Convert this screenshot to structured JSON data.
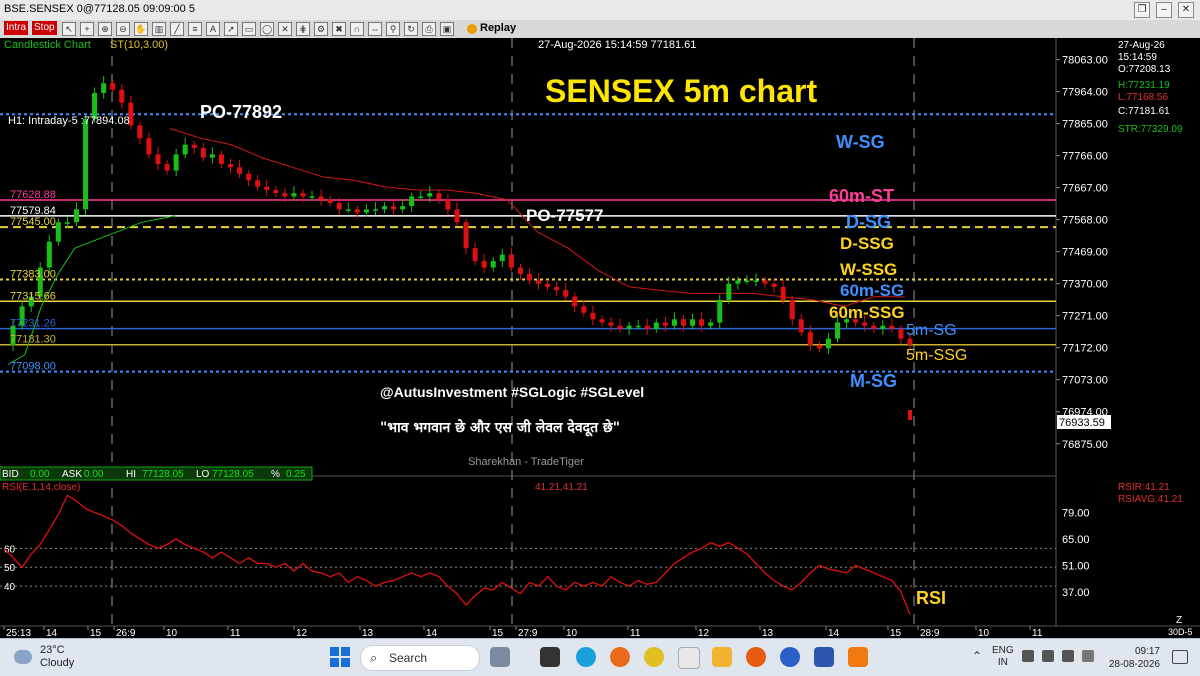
{
  "window": {
    "title": "BSE.SENSEX 0@77128.05 09:09:00 5"
  },
  "toolbar": {
    "badges": [
      "Intra",
      "Stop"
    ],
    "replay_label": "Replay"
  },
  "chart_header": {
    "chart_type_label": "Candlestick Chart",
    "indicator_label": "ST(10,3.00)",
    "datetime_label": "27-Aug-2026 15:14:59 77181.61",
    "title": "SENSEX 5m chart"
  },
  "ohlc_panel": {
    "date": "27-Aug-26",
    "time": "15:14:59",
    "open": "O:77208.13",
    "high": "H:77231.19",
    "low": "L:77168.56",
    "close": "C:77181.61",
    "str": "STR:77329.09"
  },
  "h1_label": "H1: Intraday-5 :77894.08",
  "current_price": "76933.59",
  "price_axis": [
    "78063.00",
    "77964.00",
    "77865.00",
    "77766.00",
    "77667.00",
    "77568.00",
    "77469.00",
    "77370.00",
    "77271.00",
    "77172.00",
    "77073.00",
    "76974.00",
    "76875.00"
  ],
  "levels": [
    {
      "name": "W-SG",
      "value": 77894,
      "color": "#3f8fff",
      "style": "dotted",
      "left_label": "",
      "right_label": "W-SG"
    },
    {
      "name": "60m-ST",
      "value": 77628.88,
      "color": "#ff3d9a",
      "style": "solid",
      "left_label": "77628.88",
      "right_label": "60m-ST"
    },
    {
      "name": "D-SG",
      "value": 77579.84,
      "color": "#ffffff",
      "style": "solid",
      "left_label": "77579.84",
      "right_label": "D-SG"
    },
    {
      "name": "D-SSG",
      "value": 77545,
      "color": "#e6d23a",
      "style": "dashed",
      "left_label": "77545.00",
      "right_label": "D-SSG"
    },
    {
      "name": "W-SSG",
      "value": 77383,
      "color": "#e6d23a",
      "style": "dotted",
      "left_label": "77383.00",
      "right_label": "W-SSG"
    },
    {
      "name": "60m-SG",
      "value": 77315.66,
      "color": "#e6d23a",
      "style": "solid",
      "left_label": "77315.66",
      "right_label": "60m-SG"
    },
    {
      "name": "5m-SG",
      "value": 77231.26,
      "color": "#2f62d6",
      "style": "solid",
      "left_label": "77231.26",
      "right_label": "5m-SG"
    },
    {
      "name": "5m-SSG",
      "value": 77181.3,
      "color": "#c9b230",
      "style": "solid",
      "left_label": "77181.30",
      "right_label": "5m-SSG"
    },
    {
      "name": "M-SG",
      "value": 77098,
      "color": "#3f8fff",
      "style": "dotted",
      "left_label": "77098.00",
      "right_label": "M-SG"
    }
  ],
  "annotations": {
    "po_high": "PO-77892",
    "po_mid": "PO-77577",
    "right_60m_ssg": "60m-SSG",
    "handles": "@AutusInvestment #SGLogic #SGLevel",
    "quote": "\"भाव भगवान छे और एस जी लेवल देवदूत छे\"",
    "watermark": "Sharekhan - TradeTiger",
    "rsi_label": "RSI"
  },
  "status_bar": {
    "bid_label": "BID",
    "bid_value": "0.00",
    "ask_label": "ASK",
    "ask_value": "0.00",
    "hi_label": "HI",
    "hi_value": "77128.05",
    "lo_label": "LO",
    "lo_value": "77128.05",
    "pct_label": "%",
    "pct_value": "0.25"
  },
  "rsi_panel": {
    "title": "RSI(E,1,14,close)",
    "value_center": "41.21,41.21",
    "rsir": "RSIR:41.21",
    "rsiavg": "RSIAVG:41.21",
    "axis": [
      "79.00",
      "65.00",
      "51.00",
      "37.00"
    ],
    "left_levels": [
      "60",
      "50",
      "40"
    ]
  },
  "time_axis": [
    "25:13",
    "14",
    "15",
    "26:9",
    "10",
    "11",
    "12",
    "13",
    "14",
    "15",
    "27:9",
    "10",
    "11",
    "12",
    "13",
    "14",
    "15",
    "28:9",
    "10",
    "11"
  ],
  "axis_corner": "30D-5",
  "axis_z": "Z",
  "chart_data": {
    "type": "candlestick",
    "title": "SENSEX 5m chart",
    "ylim": [
      76800,
      78130
    ],
    "price_points": [
      77180,
      77240,
      77300,
      77330,
      77420,
      77500,
      77560,
      77560,
      77600,
      77880,
      77960,
      77990,
      77970,
      77930,
      77860,
      77820,
      77770,
      77740,
      77720,
      77770,
      77800,
      77790,
      77760,
      77770,
      77740,
      77730,
      77710,
      77690,
      77670,
      77660,
      77650,
      77640,
      77650,
      77640,
      77640,
      77630,
      77620,
      77600,
      77600,
      77590,
      77600,
      77600,
      77610,
      77600,
      77610,
      77640,
      77640,
      77650,
      77630,
      77600,
      77560,
      77480,
      77440,
      77420,
      77440,
      77460,
      77420,
      77400,
      77380,
      77370,
      77360,
      77350,
      77330,
      77300,
      77280,
      77260,
      77250,
      77240,
      77230,
      77240,
      77240,
      77230,
      77250,
      77240,
      77260,
      77240,
      77260,
      77240,
      77250,
      77320,
      77370,
      77380,
      77380,
      77380,
      77370,
      77360,
      77320,
      77260,
      77220,
      77180,
      77170,
      77200,
      77250,
      77260,
      77250,
      77240,
      77230,
      77240,
      77230,
      77200,
      77181
    ],
    "rsi_points": [
      60,
      55,
      50,
      57,
      62,
      70,
      78,
      88,
      85,
      81,
      79,
      77,
      75,
      72,
      68,
      65,
      62,
      60,
      62,
      65,
      62,
      60,
      58,
      55,
      58,
      55,
      52,
      55,
      52,
      52,
      50,
      52,
      48,
      52,
      48,
      47,
      45,
      47,
      42,
      45,
      43,
      40,
      42,
      43,
      45,
      47,
      45,
      47,
      45,
      40,
      36,
      30,
      35,
      39,
      38,
      42,
      39,
      36,
      42,
      40,
      45,
      40,
      38,
      42,
      40,
      42,
      40,
      45,
      42,
      40,
      43,
      41,
      42,
      47,
      52,
      55,
      58,
      60,
      63,
      61,
      63,
      60,
      57,
      52,
      47,
      43,
      40,
      38,
      42,
      47,
      51,
      49,
      48,
      47,
      51,
      49,
      47,
      45,
      43,
      37,
      25
    ],
    "rsi_ylim": [
      20,
      94
    ],
    "supertrend_red_points": [
      77850,
      77820,
      77800,
      77760,
      77730,
      77700,
      77690,
      77670,
      77660,
      77660,
      77650,
      77630,
      77530,
      77480,
      77410,
      77360,
      77350,
      77340,
      77340,
      77340,
      77330,
      77320,
      77300,
      77330,
      77329
    ],
    "supertrend_green_points": [
      77120,
      77150,
      77300,
      77400,
      77480,
      77500,
      77520,
      77540,
      77560,
      77570,
      77580
    ],
    "day_separators": [
      "26:9",
      "27:9",
      "28:9"
    ]
  },
  "taskbar": {
    "weather_temp": "23°C",
    "weather_desc": "Cloudy",
    "search_placeholder": "Search",
    "lang_line1": "ENG",
    "lang_line2": "IN",
    "time": "09:17",
    "date": "28-08-2026"
  }
}
